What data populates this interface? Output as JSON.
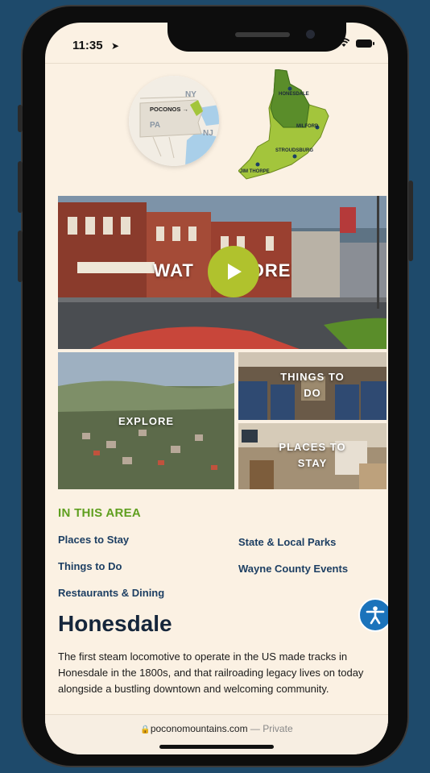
{
  "status_bar": {
    "time": "11:35"
  },
  "locator_map": {
    "labels": [
      "NY",
      "POCONOS",
      "PA",
      "NJ"
    ]
  },
  "region_map": {
    "labels": [
      "HONESDALE",
      "MILFORD",
      "STROUDSBURG",
      "JIM THORPE"
    ]
  },
  "hero": {
    "label_left": "WAT",
    "label_right": "ORE"
  },
  "tiles": {
    "explore": "EXPLORE",
    "things_to_do": [
      "THINGS TO",
      "DO"
    ],
    "places_to_stay": [
      "PLACES TO",
      "STAY"
    ]
  },
  "area": {
    "title": "IN THIS AREA",
    "links_left": [
      "Places to Stay",
      "Things to Do",
      "Restaurants & Dining"
    ],
    "links_right": [
      "State & Local Parks",
      "Wayne County Events"
    ]
  },
  "page": {
    "title": "Honesdale",
    "body": "The first steam locomotive to operate in the US made tracks in Honesdale in the 1800s, and that railroading legacy lives on today alongside a bustling downtown and welcoming community."
  },
  "browser": {
    "url": "poconomountains.com",
    "separator": "—",
    "privacy": "Private"
  },
  "colors": {
    "accent_green": "#5f9f1f",
    "link_navy": "#1d3f63",
    "play_lime": "#b0c22d",
    "a11y_blue": "#1b73bb"
  }
}
